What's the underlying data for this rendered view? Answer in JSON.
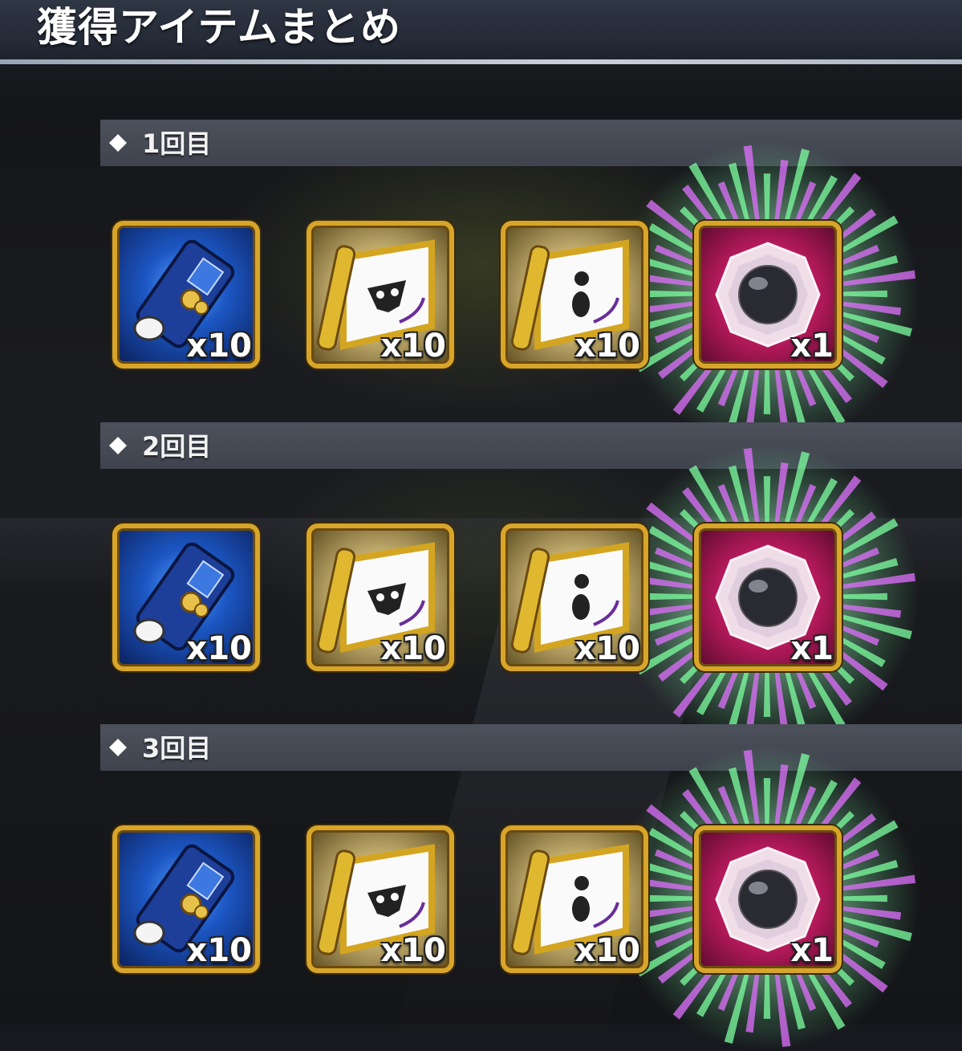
{
  "header": {
    "title": "獲得アイテムまとめ"
  },
  "rounds": [
    {
      "label": "1回目",
      "items": [
        {
          "icon": "blue-scroll-icon",
          "quantity": "x10"
        },
        {
          "icon": "gold-scroll-mask-icon",
          "quantity": "x10"
        },
        {
          "icon": "gold-scroll-dots-icon",
          "quantity": "x10"
        },
        {
          "icon": "crystal-orb-icon",
          "quantity": "x1"
        }
      ]
    },
    {
      "label": "2回目",
      "items": [
        {
          "icon": "blue-scroll-icon",
          "quantity": "x10"
        },
        {
          "icon": "gold-scroll-mask-icon",
          "quantity": "x10"
        },
        {
          "icon": "gold-scroll-dots-icon",
          "quantity": "x10"
        },
        {
          "icon": "crystal-orb-icon",
          "quantity": "x1"
        }
      ]
    },
    {
      "label": "3回目",
      "items": [
        {
          "icon": "blue-scroll-icon",
          "quantity": "x10"
        },
        {
          "icon": "gold-scroll-mask-icon",
          "quantity": "x10"
        },
        {
          "icon": "gold-scroll-dots-icon",
          "quantity": "x10"
        },
        {
          "icon": "crystal-orb-icon",
          "quantity": "x1"
        }
      ]
    }
  ],
  "colors": {
    "frame_gold": "#d7a52a",
    "section_bar": "#4d515c",
    "rare_burst_green": "#7dffa0",
    "rare_burst_magenta": "#e070ff"
  }
}
